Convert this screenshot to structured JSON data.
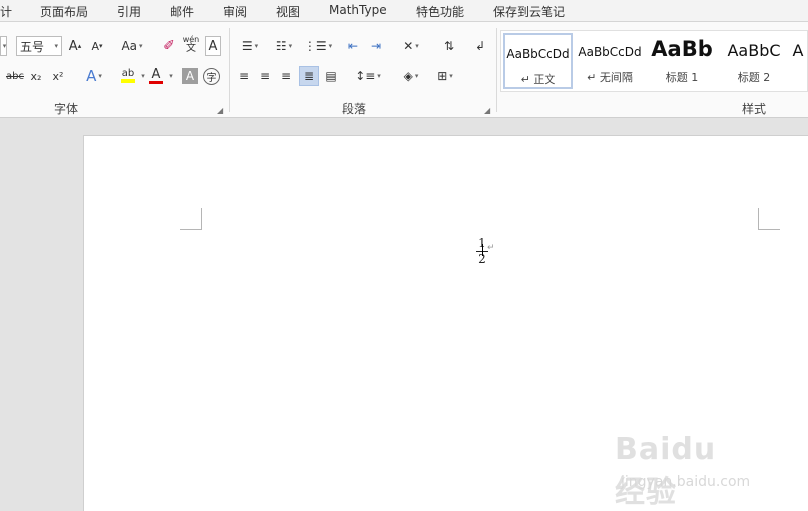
{
  "menu": {
    "tabs": [
      "计",
      "页面布局",
      "引用",
      "邮件",
      "审阅",
      "视图",
      "MathType",
      "特色功能",
      "保存到云笔记"
    ]
  },
  "font_group": {
    "label": "字体",
    "font_size": "五号",
    "grow_font": "A",
    "shrink_font": "A",
    "change_case": "Aa",
    "pinyin_guide_top": "wén",
    "pinyin_guide_bottom": "文",
    "char_border": "A",
    "strikethrough": "abc",
    "subscript": "x₂",
    "superscript": "x²",
    "text_effects": "A",
    "highlight": "ab",
    "font_color": "A",
    "char_shading": "A",
    "enclose_char": "字",
    "highlight_color": "#ffff00",
    "font_color_value": "#e00000"
  },
  "paragraph_group": {
    "label": "段落"
  },
  "styles_group": {
    "label": "样式",
    "items": [
      {
        "preview": "AaBbCcDd",
        "name": "↵ 正文"
      },
      {
        "preview": "AaBbCcDd",
        "name": "↵ 无间隔"
      },
      {
        "preview": "AaBb",
        "name": "标题 1"
      },
      {
        "preview": "AaBbC",
        "name": "标题 2"
      },
      {
        "preview": "A",
        "name": ""
      }
    ]
  },
  "document": {
    "fraction_numerator": "1",
    "fraction_denominator": "2",
    "paragraph_mark": "↵"
  },
  "watermark": {
    "logo": "Baidu经验",
    "url": "jingyan.baidu.com"
  }
}
